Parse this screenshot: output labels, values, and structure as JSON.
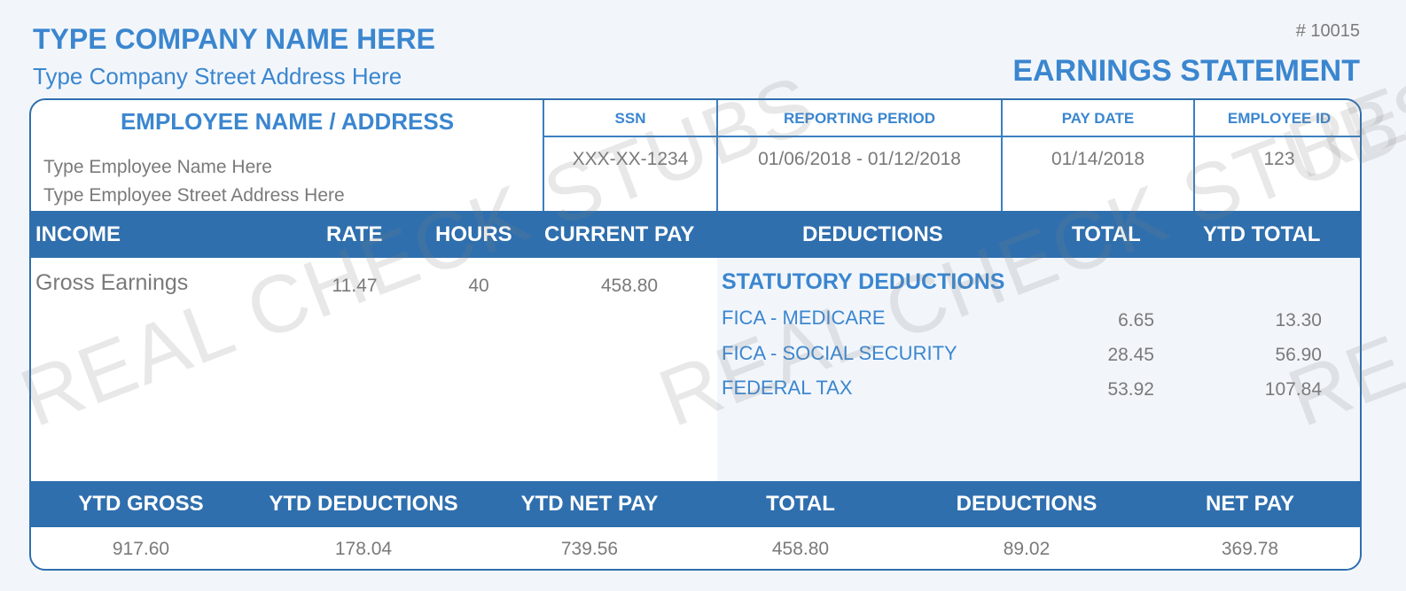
{
  "header": {
    "company_name": "TYPE COMPANY NAME HERE",
    "company_address": "Type Company Street Address Here",
    "check_number": "# 10015",
    "statement_title": "EARNINGS STATEMENT"
  },
  "employee": {
    "heading": "EMPLOYEE NAME / ADDRESS",
    "name": "Type Employee Name Here",
    "address": "Type Employee Street Address Here"
  },
  "info": {
    "ssn_label": "SSN",
    "ssn": "XXX-XX-1234",
    "period_label": "REPORTING PERIOD",
    "period": "01/06/2018 - 01/12/2018",
    "paydate_label": "PAY DATE",
    "paydate": "01/14/2018",
    "empid_label": "EMPLOYEE ID",
    "empid": "123"
  },
  "columns": {
    "income": "INCOME",
    "rate": "RATE",
    "hours": "HOURS",
    "current_pay": "CURRENT PAY",
    "deductions": "DEDUCTIONS",
    "total": "TOTAL",
    "ytd_total": "YTD TOTAL"
  },
  "income_row": {
    "label": "Gross Earnings",
    "rate": "11.47",
    "hours": "40",
    "current_pay": "458.80"
  },
  "statutory": {
    "title": "STATUTORY DEDUCTIONS",
    "items": [
      {
        "name": "FICA - MEDICARE",
        "total": "6.65",
        "ytd": "13.30"
      },
      {
        "name": "FICA - SOCIAL SECURITY",
        "total": "28.45",
        "ytd": "56.90"
      },
      {
        "name": "FEDERAL TAX",
        "total": "53.92",
        "ytd": "107.84"
      }
    ]
  },
  "summary": {
    "labels": [
      "YTD GROSS",
      "YTD DEDUCTIONS",
      "YTD NET PAY",
      "TOTAL",
      "DEDUCTIONS",
      "NET PAY"
    ],
    "values": [
      "917.60",
      "178.04",
      "739.56",
      "458.80",
      "89.02",
      "369.78"
    ]
  },
  "watermark": "REAL CHECK STUBS"
}
